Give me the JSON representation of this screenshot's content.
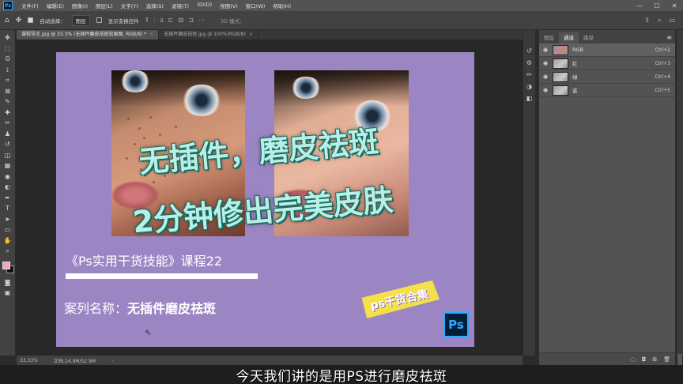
{
  "app": {
    "logo": "Ps",
    "menu": [
      "文件(F)",
      "编辑(E)",
      "图像(I)",
      "图层(L)",
      "文字(Y)",
      "选择(S)",
      "滤镜(T)",
      "3D(D)",
      "视图(V)",
      "窗口(W)",
      "帮助(H)"
    ],
    "window_controls": [
      "—",
      "☐",
      "✕"
    ]
  },
  "options": {
    "auto_select_label": "自动选择：",
    "auto_select_value": "图层",
    "show_transform_label": "显示变换控件",
    "mode_label": "3D 模式："
  },
  "tools": [
    "move-tool",
    "marquee-tool",
    "lasso-tool",
    "quick-select-tool",
    "crop-tool",
    "frame-tool",
    "eyedropper-tool",
    "healing-tool",
    "brush-tool",
    "stamp-tool",
    "history-brush-tool",
    "eraser-tool",
    "gradient-tool",
    "blur-tool",
    "dodge-tool",
    "pen-tool",
    "type-tool",
    "path-select-tool",
    "shape-tool",
    "hand-tool",
    "zoom-tool"
  ],
  "tool_glyphs": [
    "✥",
    "⬚",
    "ʘ",
    "⟟",
    "⌗",
    "⊠",
    "✎",
    "✚",
    "✏",
    "♟",
    "↺",
    "◫",
    "▦",
    "◉",
    "◐",
    "✒",
    "T",
    "➤",
    "▭",
    "✋",
    "⌕"
  ],
  "colors": {
    "foreground": "#f3a6b5",
    "background": "#111111",
    "artboard": "#9c85c3",
    "accent": "#31a8ff"
  },
  "tabs": [
    {
      "label": "课程导言.jpg @ 33.3% (无插件磨皮祛斑效果图, RGB/8) *",
      "active": true
    },
    {
      "label": "无插件磨皮祛斑.jpg @ 100%(RGB/8)",
      "active": false
    }
  ],
  "artboard": {
    "title_line1": "无插件，磨皮祛斑",
    "title_line2": "2分钟修出完美皮肤",
    "course": "《Ps实用干货技能》课程22",
    "case_prefix": "案列名称：",
    "case_name": "无插件磨皮祛斑",
    "sticker": "ps干货合集",
    "badge": "Ps"
  },
  "panel": {
    "tabs": [
      "图层",
      "通道",
      "路径"
    ],
    "active_tab": "通道",
    "channels": [
      {
        "name": "RGB",
        "key": "Ctrl+2",
        "thumb": "rgb",
        "selected": true
      },
      {
        "name": "红",
        "key": "Ctrl+3",
        "thumb": "gray",
        "selected": false
      },
      {
        "name": "绿",
        "key": "Ctrl+4",
        "thumb": "gray",
        "selected": false
      },
      {
        "name": "蓝",
        "key": "Ctrl+5",
        "thumb": "gray",
        "selected": false
      }
    ]
  },
  "status": {
    "zoom": "33.33%",
    "doc": "文档:24.9M/52.9M"
  },
  "subtitle": "今天我们讲的是用PS进行磨皮祛斑"
}
